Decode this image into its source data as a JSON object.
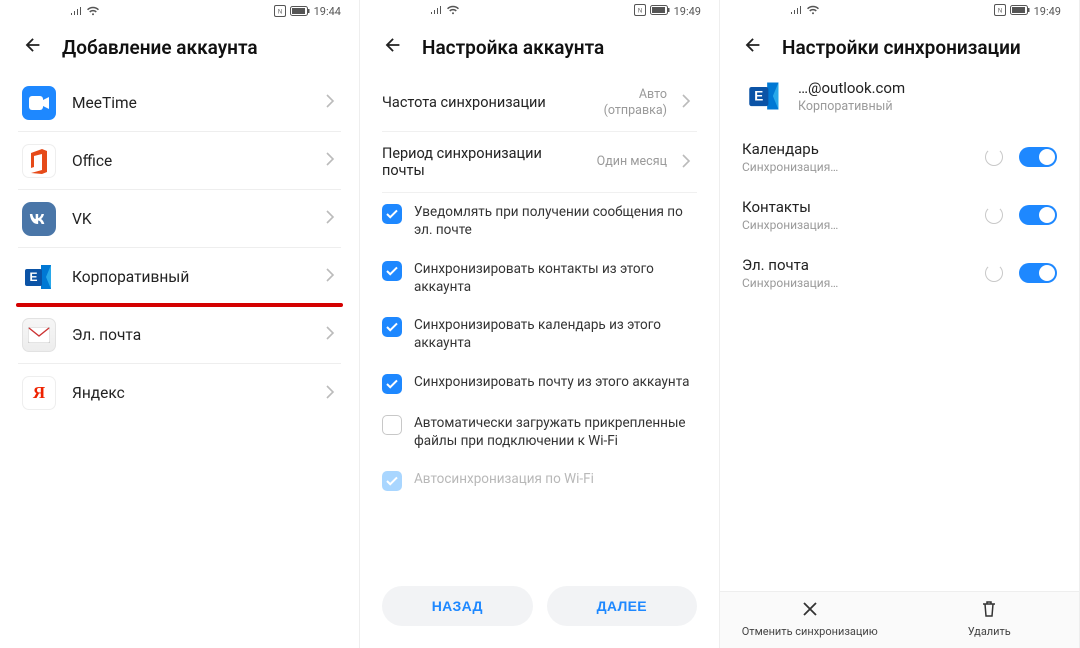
{
  "screen1": {
    "statusbar_time": "19:44",
    "title": "Добавление аккаунта",
    "items": [
      {
        "label": "MeeTime"
      },
      {
        "label": "Office"
      },
      {
        "label": "VK"
      },
      {
        "label": "Корпоративный"
      },
      {
        "label": "Эл. почта"
      },
      {
        "label": "Яндекс"
      }
    ]
  },
  "screen2": {
    "statusbar_time": "19:49",
    "title": "Настройка аккаунта",
    "freq_label": "Частота синхронизации",
    "freq_value_line1": "Авто",
    "freq_value_line2": "(отправка)",
    "period_label": "Период синхронизации почты",
    "period_value": "Один месяц",
    "checks": [
      {
        "label": "Уведомлять при получении сообщения по эл. почте",
        "state": "checked"
      },
      {
        "label": "Синхронизировать контакты из этого аккаунта",
        "state": "checked"
      },
      {
        "label": "Синхронизировать календарь из этого аккаунта",
        "state": "checked"
      },
      {
        "label": "Синхронизировать почту из этого аккаунта",
        "state": "checked"
      },
      {
        "label": "Автоматически загружать прикрепленные файлы при подключении к Wi-Fi",
        "state": "unchecked"
      },
      {
        "label": "Автосинхронизация по Wi-Fi",
        "state": "disabled"
      }
    ],
    "back_btn": "НАЗАД",
    "next_btn": "ДАЛЕЕ"
  },
  "screen3": {
    "statusbar_time": "19:49",
    "title": "Настройки синхронизации",
    "email": "…@outlook.com",
    "account_type": "Корпоративный",
    "items": [
      {
        "title": "Календарь",
        "sub": "Синхронизация…"
      },
      {
        "title": "Контакты",
        "sub": "Синхронизация…"
      },
      {
        "title": "Эл. почта",
        "sub": "Синхронизация…"
      }
    ],
    "cancel_label": "Отменить синхронизацию",
    "delete_label": "Удалить"
  }
}
